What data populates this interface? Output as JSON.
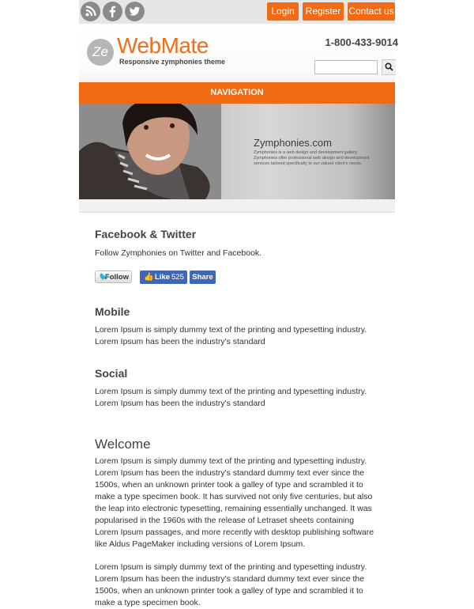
{
  "topbar": {
    "social_icons": [
      {
        "name": "rss-icon",
        "glyph": "))"
      },
      {
        "name": "facebook-icon",
        "glyph": "f"
      },
      {
        "name": "twitter-icon",
        "glyph": "t"
      }
    ],
    "buttons": [
      "Login",
      "Register",
      "Contact us"
    ],
    "accent_color": "#f26b14"
  },
  "header": {
    "logo_mark": "Ze",
    "logo_title": "WebMate",
    "logo_tagline": "Responsive zymphonies theme",
    "phone": "1-800-433-9014",
    "search": {
      "value": "",
      "placeholder": "",
      "button_icon": "search-icon"
    }
  },
  "nav": {
    "label": "NAVIGATION"
  },
  "hero": {
    "title": "Zymphonies.com",
    "description": "Zymphonies is a web design and development gallery. Zymphonies offer professional web design and development services tailored specifically to our valued client's needs."
  },
  "sections": {
    "fb_twitter": {
      "title": "Facebook & Twitter",
      "text": "Follow Zymphonies on Twitter and Facebook.",
      "follow_label": "Follow",
      "like_label": "Like",
      "like_count": "525",
      "share_label": "Share"
    },
    "mobile": {
      "title": "Mobile",
      "text": "Lorem Ipsum is simply dummy text of the printing and typesetting industry. Lorem Ipsum has been the industry's standard"
    },
    "social": {
      "title": "Social",
      "text": "Lorem Ipsum is simply dummy text of the printing and typesetting industry. Lorem Ipsum has been the industry's standard"
    },
    "welcome": {
      "title": "Welcome",
      "paragraph1": "Lorem Ipsum is simply dummy text of the printing and typesetting industry. Lorem Ipsum has been the industry's standard dummy text ever since the 1500s, when an unknown printer took a galley of type and scrambled it to make a type specimen book. It has survived not only five centuries, but also the leap into electronic typesetting, remaining essentially unchanged. It was popularised in the 1960s with the release of Letraset sheets containing Lorem Ipsum passages, and more recently with desktop publishing software like Aldus PageMaker including versions of Lorem Ipsum.",
      "paragraph2": "Lorem Ipsum is simply dummy text of the printing and typesetting industry. Lorem Ipsum has been the industry's standard dummy text ever since the 1500s, when an unknown printer took a galley of type and scrambled it to make a type specimen book."
    }
  }
}
